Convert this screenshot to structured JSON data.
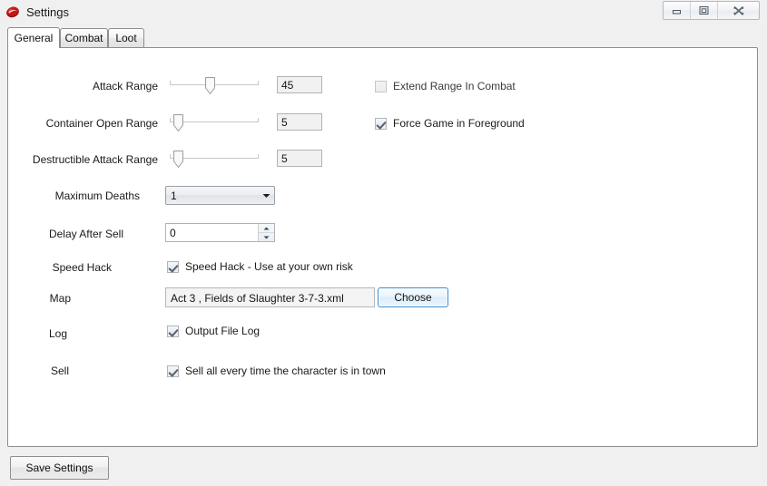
{
  "window": {
    "title": "Settings",
    "icon": "app-logo-icon",
    "controls": [
      {
        "name": "minimize-button",
        "glyph": "minimize-icon"
      },
      {
        "name": "maximize-button",
        "glyph": "maximize-icon"
      },
      {
        "name": "close-button",
        "glyph": "close-icon"
      }
    ]
  },
  "tabs": [
    {
      "label": "General",
      "selected": true
    },
    {
      "label": "Combat",
      "selected": false
    },
    {
      "label": "Loot",
      "selected": false
    }
  ],
  "general": {
    "sliders": [
      {
        "label": "Attack Range",
        "value": "45",
        "percent": 45
      },
      {
        "label": "Container Open Range",
        "value": "5",
        "percent": 5
      },
      {
        "label": "Destructible Attack Range",
        "value": "5",
        "percent": 5
      }
    ],
    "right_checkboxes": [
      {
        "label": "Extend Range In Combat",
        "checked": false
      },
      {
        "label": "Force Game in Foreground",
        "checked": true
      }
    ],
    "maximum_deaths": {
      "label": "Maximum Deaths",
      "value": "1",
      "options": [
        "1"
      ]
    },
    "delay_after_sell": {
      "label": "Delay After Sell",
      "value": "0"
    },
    "speed_hack": {
      "label": "Speed Hack",
      "checkbox_label": "Speed Hack - Use at your own risk",
      "checked": true
    },
    "map": {
      "label": "Map",
      "value": "Act 3 , Fields of Slaughter 3-7-3.xml",
      "button_label": "Choose"
    },
    "log": {
      "label": "Log",
      "checkbox_label": "Output File Log",
      "checked": true
    },
    "sell": {
      "label": "Sell",
      "checkbox_label": "Sell all every time the character is in town",
      "checked": true
    }
  },
  "footer": {
    "save_label": "Save Settings"
  },
  "colors": {
    "accent_focus": "#3c8cc6",
    "window_bg": "#f0f0f0",
    "panel_bg": "#ffffff",
    "icon_red": "#b11212"
  }
}
